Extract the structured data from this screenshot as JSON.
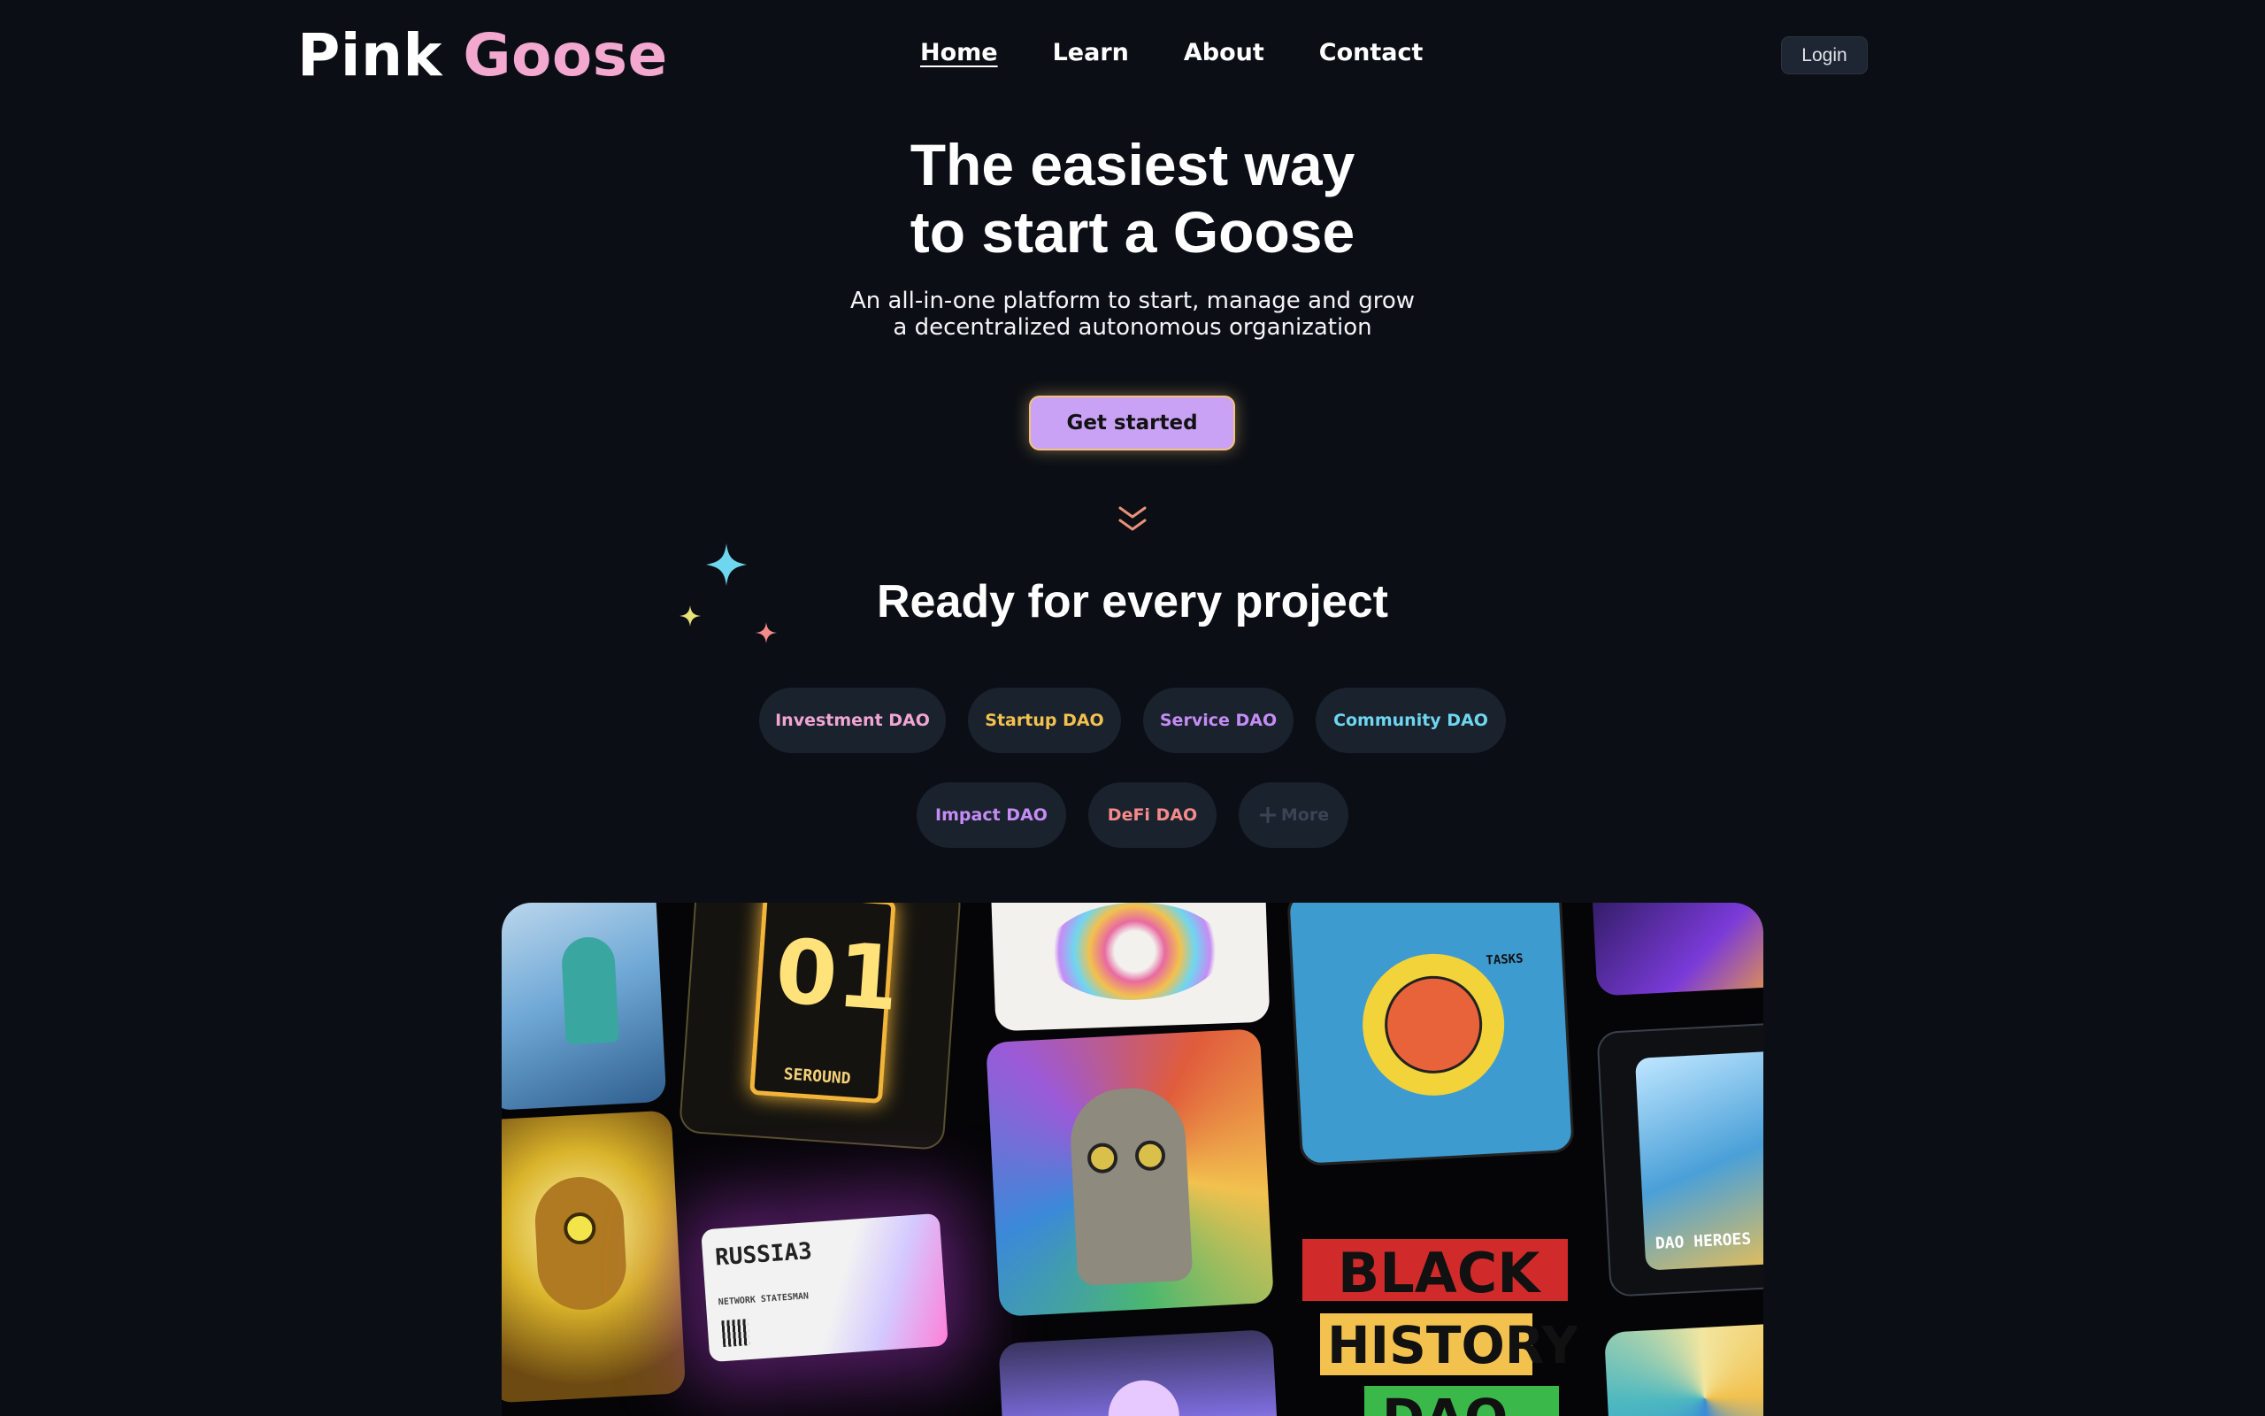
{
  "brand": {
    "first": "Pink",
    "second": "Goose"
  },
  "nav": {
    "items": [
      {
        "label": "Home",
        "active": true
      },
      {
        "label": "Learn"
      },
      {
        "label": "About"
      },
      {
        "label": "Contact"
      }
    ],
    "login_label": "Login"
  },
  "hero": {
    "title_line1": "The easiest way",
    "title_line2": "to start a Goose",
    "subtitle_line1": "An all-in-one platform to start, manage and grow",
    "subtitle_line2": "a decentralized autonomous organization",
    "cta_label": "Get started"
  },
  "projects": {
    "title": "Ready for every project",
    "pills": [
      {
        "label": "Investment DAO",
        "color": "#f0a6d0"
      },
      {
        "label": "Startup DAO",
        "color": "#f2c14e"
      },
      {
        "label": "Service DAO",
        "color": "#c58cf5"
      },
      {
        "label": "Community DAO",
        "color": "#6fd6f0"
      },
      {
        "label": "Impact DAO",
        "color": "#c58cf5"
      },
      {
        "label": "DeFi DAO",
        "color": "#f48a8a"
      }
    ],
    "more_label": "More"
  },
  "gallery": {
    "card_01": "01",
    "card_seround": "SEROUND",
    "card_russia": "RUSSIA3",
    "card_network": "NETWORK STATESMAN",
    "card_blackhistory_1": "BLACK",
    "card_blackhistory_2": "HISTORY",
    "card_blackhistory_3": "DAO",
    "card_heroes": "DAO HEROES",
    "card_tasks": "TASKS"
  },
  "colors": {
    "background": "#0b0f15",
    "brand_pink": "#f3a8cf",
    "cta": "#c9a2f6",
    "cta_border": "#f3c27a"
  }
}
